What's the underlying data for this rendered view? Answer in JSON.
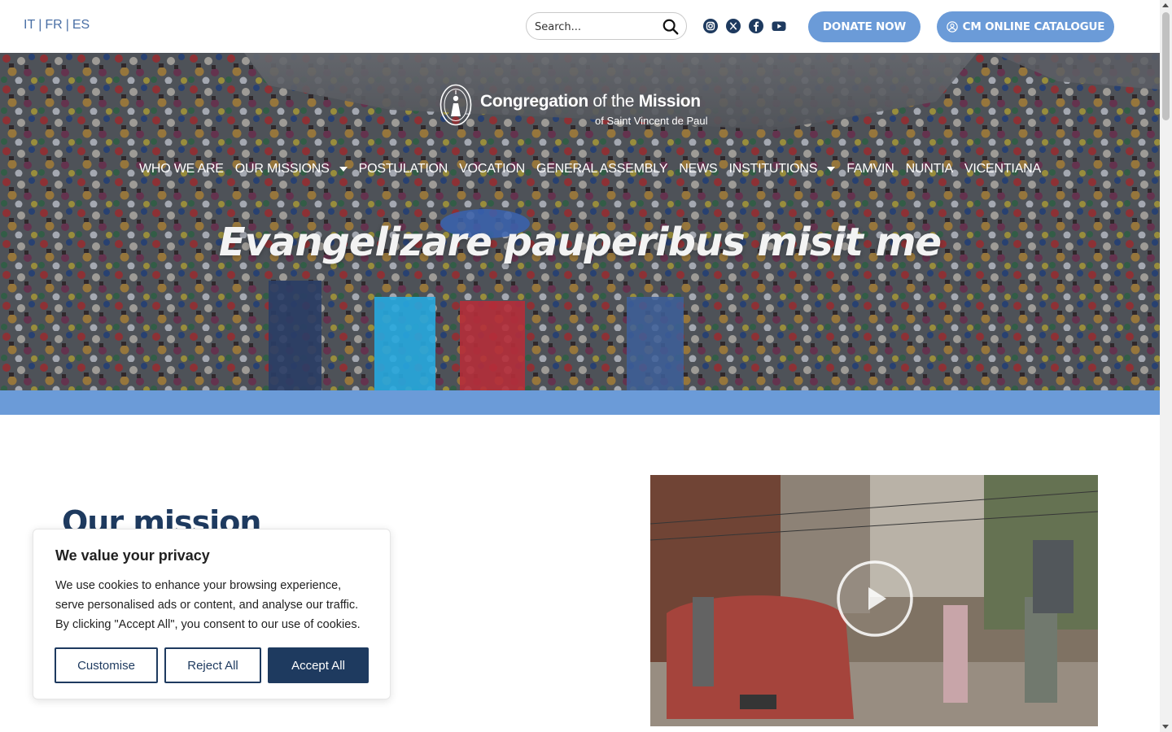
{
  "topbar": {
    "languages": [
      "IT",
      "FR",
      "ES"
    ],
    "search": {
      "placeholder": "Search..."
    },
    "social_icons": [
      "instagram-icon",
      "x-icon",
      "facebook-icon",
      "youtube-icon"
    ],
    "donate_label": "DONATE NOW",
    "catalogue_label": "CM ONLINE CATALOGUE"
  },
  "logo": {
    "name_part1": "Congregation",
    "name_part2": " of the ",
    "name_part3": "Mission",
    "subtitle": "of Saint Vincent de Paul"
  },
  "nav": {
    "items": [
      {
        "label": "WHO WE ARE"
      },
      {
        "label": "OUR MISSIONS"
      },
      {
        "label": "POSTULATION"
      },
      {
        "label": "VOCATION"
      },
      {
        "label": "GENERAL ASSEMBLY"
      },
      {
        "label": "NEWS"
      },
      {
        "label": "INSTITUTIONS"
      },
      {
        "label": "FAMVIN"
      },
      {
        "label": "NUNTIA"
      },
      {
        "label": "VICENTIANA"
      }
    ]
  },
  "hero": {
    "title": "Evangelizare pauperibus misit me"
  },
  "section": {
    "title": "Our mission"
  },
  "cookie": {
    "title": "We value your privacy",
    "text": "We use cookies to enhance your browsing experience, serve personalised ads or content, and analyse our traffic. By clicking \"Accept All\", you consent to our use of cookies.",
    "customise_label": "Customise",
    "reject_label": "Reject All",
    "accept_label": "Accept All"
  },
  "colors": {
    "accent_blue": "#6b9bd8",
    "navy": "#1e3a5f",
    "link_blue": "#4a6fa5"
  }
}
